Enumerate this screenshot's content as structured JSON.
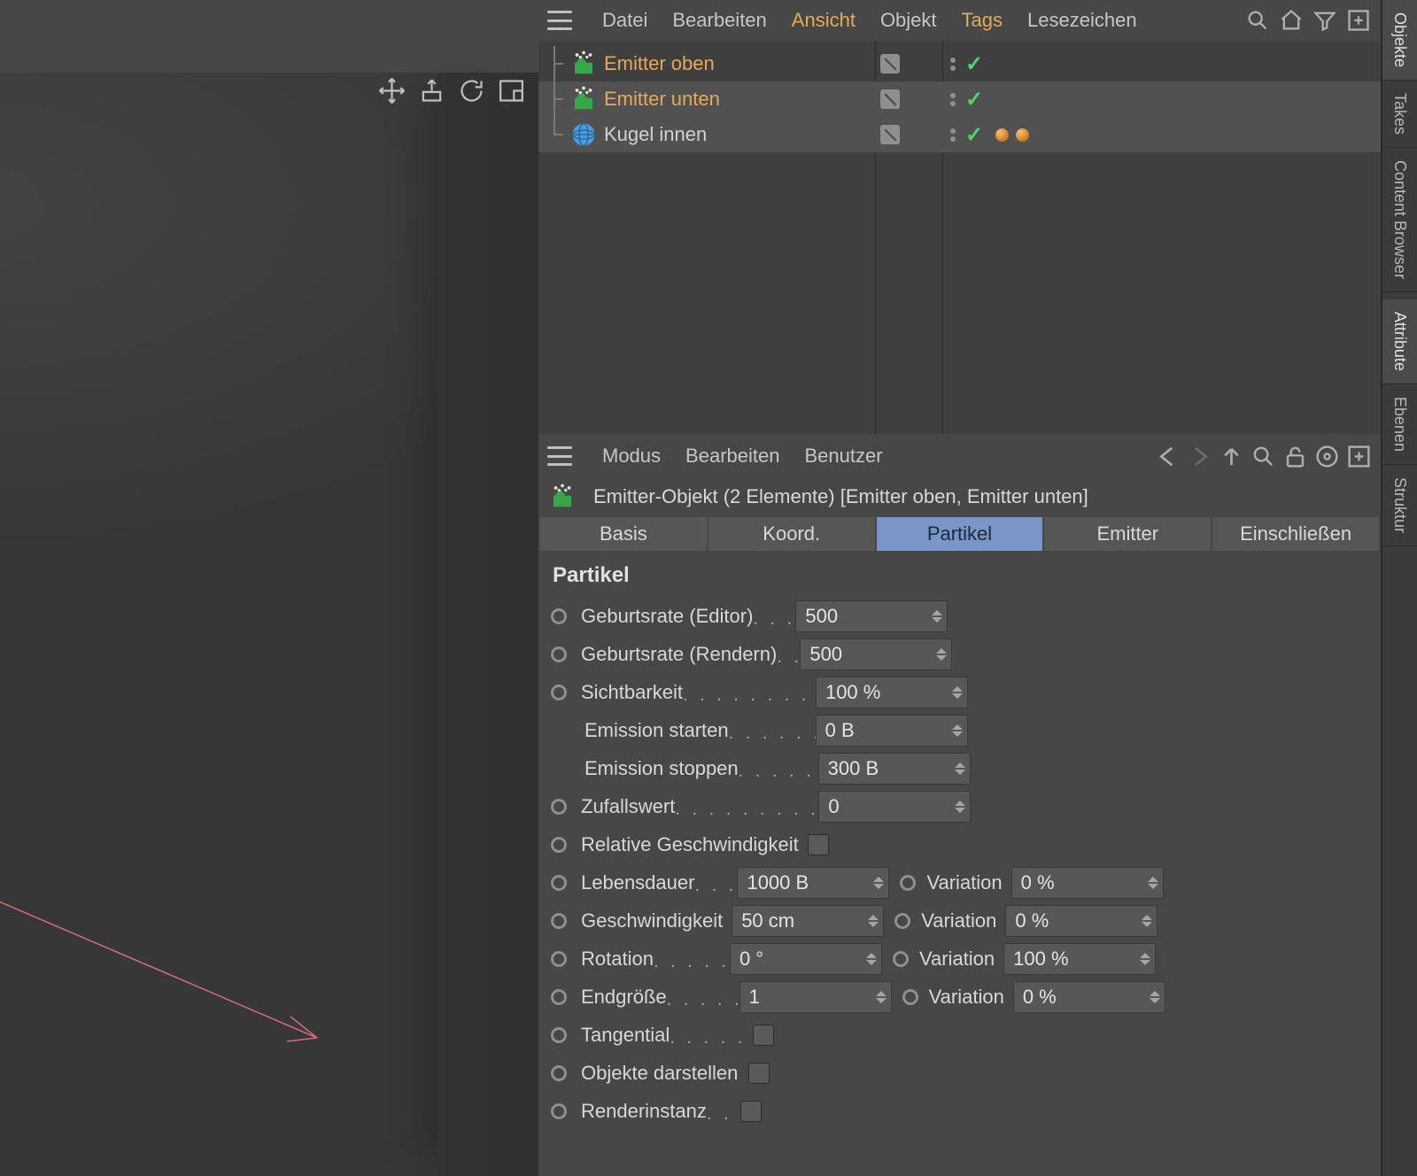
{
  "viewport": {
    "tool_icons": [
      "move-icon",
      "extrude-icon",
      "rotate-icon",
      "frame-icon"
    ]
  },
  "object_manager": {
    "menu": {
      "file": "Datei",
      "edit": "Bearbeiten",
      "view": "Ansicht",
      "object": "Objekt",
      "tags": "Tags",
      "bookmarks": "Lesezeichen"
    },
    "items": [
      {
        "name": "Emitter oben",
        "type": "emitter",
        "selected": false,
        "tags": []
      },
      {
        "name": "Emitter unten",
        "type": "emitter",
        "selected": true,
        "tags": []
      },
      {
        "name": "Kugel innen",
        "type": "sphere",
        "selected": true,
        "tags": [
          "texture",
          "texture"
        ]
      }
    ]
  },
  "attribute_manager": {
    "menu": {
      "mode": "Modus",
      "edit": "Bearbeiten",
      "user": "Benutzer"
    },
    "title": "Emitter-Objekt (2 Elemente) [Emitter oben, Emitter unten]",
    "tabs": {
      "basis": "Basis",
      "coord": "Koord.",
      "particle": "Partikel",
      "emitter": "Emitter",
      "include": "Einschließen"
    },
    "section_title": "Partikel",
    "params": {
      "birth_editor": {
        "label": "Geburtsrate (Editor)",
        "value": "500"
      },
      "birth_render": {
        "label": "Geburtsrate (Rendern)",
        "value": "500"
      },
      "visibility": {
        "label": "Sichtbarkeit",
        "value": "100 %"
      },
      "emit_start": {
        "label": "Emission starten",
        "value": "0 B"
      },
      "emit_stop": {
        "label": "Emission stoppen",
        "value": "300 B"
      },
      "seed": {
        "label": "Zufallswert",
        "value": "0"
      },
      "rel_speed": {
        "label": "Relative Geschwindigkeit"
      },
      "lifetime": {
        "label": "Lebensdauer",
        "value": "1000 B",
        "var_label": "Variation",
        "var_value": "0 %"
      },
      "speed": {
        "label": "Geschwindigkeit",
        "value": "50 cm",
        "var_label": "Variation",
        "var_value": "0 %"
      },
      "rotation": {
        "label": "Rotation",
        "value": "0 °",
        "var_label": "Variation",
        "var_value": "100 %"
      },
      "end_size": {
        "label": "Endgröße",
        "value": "1",
        "var_label": "Variation",
        "var_value": "0 %"
      },
      "tangential": {
        "label": "Tangential"
      },
      "show_objects": {
        "label": "Objekte darstellen"
      },
      "render_inst": {
        "label": "Renderinstanz"
      }
    }
  },
  "side_tabs": {
    "objects": "Objekte",
    "takes": "Takes",
    "content": "Content Browser",
    "attribute": "Attribute",
    "layers": "Ebenen",
    "structure": "Struktur"
  }
}
